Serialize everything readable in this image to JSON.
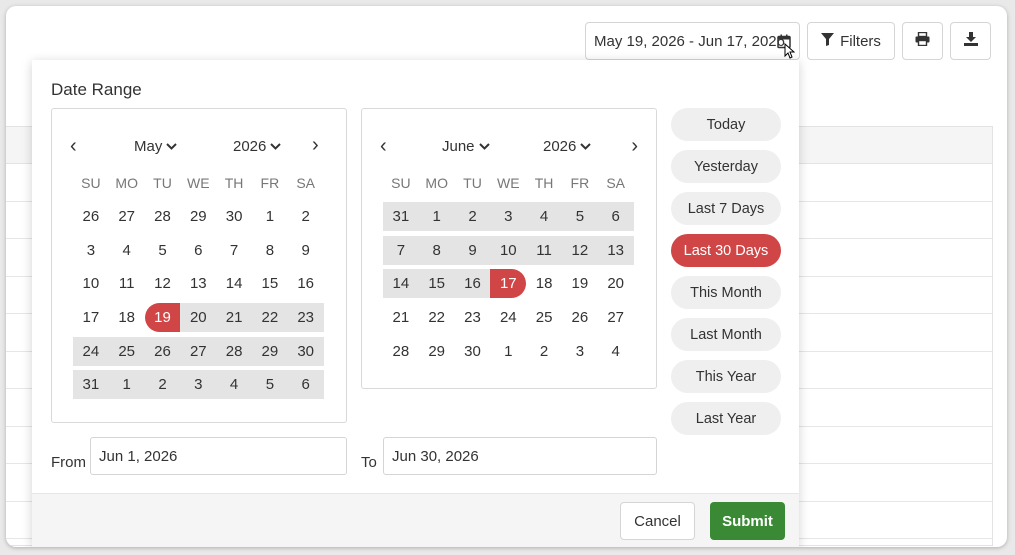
{
  "toolbar": {
    "date_range_label": "May 19, 2026 - Jun 17, 2026",
    "filters_label": "Filters"
  },
  "popover": {
    "title": "Date Range",
    "weekdays": [
      "SU",
      "MO",
      "TU",
      "WE",
      "TH",
      "FR",
      "SA"
    ],
    "left_calendar": {
      "month": "May",
      "year": "2026",
      "weeks": [
        [
          "26",
          "27",
          "28",
          "29",
          "30",
          "1",
          "2"
        ],
        [
          "3",
          "4",
          "5",
          "6",
          "7",
          "8",
          "9"
        ],
        [
          "10",
          "11",
          "12",
          "13",
          "14",
          "15",
          "16"
        ],
        [
          "17",
          "18",
          "19",
          "20",
          "21",
          "22",
          "23"
        ],
        [
          "24",
          "25",
          "26",
          "27",
          "28",
          "29",
          "30"
        ],
        [
          "31",
          "1",
          "2",
          "3",
          "4",
          "5",
          "6"
        ]
      ]
    },
    "right_calendar": {
      "month": "June",
      "year": "2026",
      "weeks": [
        [
          "31",
          "1",
          "2",
          "3",
          "4",
          "5",
          "6"
        ],
        [
          "7",
          "8",
          "9",
          "10",
          "11",
          "12",
          "13"
        ],
        [
          "14",
          "15",
          "16",
          "17",
          "18",
          "19",
          "20"
        ],
        [
          "21",
          "22",
          "23",
          "24",
          "25",
          "26",
          "27"
        ],
        [
          "28",
          "29",
          "30",
          "1",
          "2",
          "3",
          "4"
        ]
      ]
    },
    "presets": [
      "Today",
      "Yesterday",
      "Last 7 Days",
      "Last 30 Days",
      "This Month",
      "Last Month",
      "This Year",
      "Last Year"
    ],
    "active_preset": "Last 30 Days",
    "from_label": "From",
    "from_value": "Jun 1, 2026",
    "to_label": "To",
    "to_value": "Jun 30, 2026",
    "cancel_label": "Cancel",
    "submit_label": "Submit"
  },
  "colors": {
    "accent_red": "#d04646",
    "submit_green": "#3a8a35",
    "range_gray": "#e4e4e4"
  }
}
